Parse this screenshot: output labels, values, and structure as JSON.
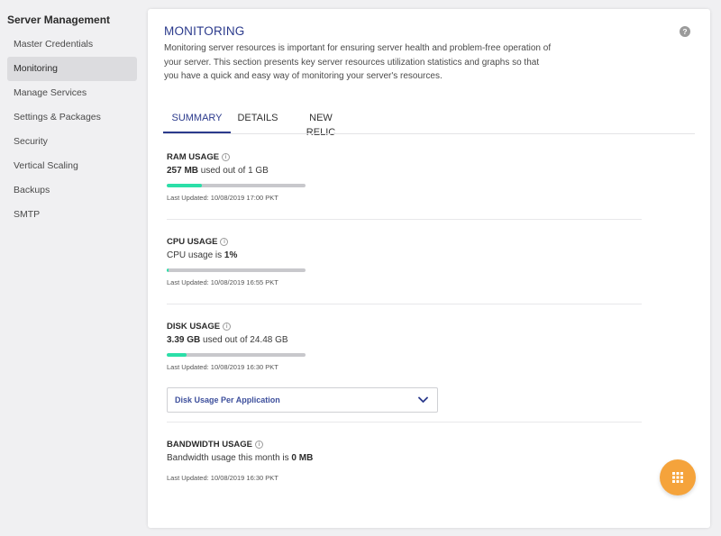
{
  "sidebar": {
    "title": "Server Management",
    "items": [
      {
        "label": "Master Credentials"
      },
      {
        "label": "Monitoring"
      },
      {
        "label": "Manage Services"
      },
      {
        "label": "Settings & Packages"
      },
      {
        "label": "Security"
      },
      {
        "label": "Vertical Scaling"
      },
      {
        "label": "Backups"
      },
      {
        "label": "SMTP"
      }
    ],
    "active_item": "Monitoring"
  },
  "main": {
    "title": "MONITORING",
    "intro": "Monitoring server resources is important for ensuring server health and problem-free operation of your server. This section presents key server resources utilization statistics and graphs so that you have a quick and easy way of monitoring your server's resources.",
    "tabs": [
      {
        "label": "SUMMARY"
      },
      {
        "label": "DETAILS"
      },
      {
        "label": "NEW RELIC"
      }
    ],
    "active_tab": "SUMMARY",
    "ram": {
      "title": "RAM USAGE",
      "used": "257 MB",
      "text_mid": "used out of",
      "total": "1 GB",
      "progress_fraction": 0.25,
      "updated": "Last Updated: 10/08/2019 17:00 PKT"
    },
    "cpu": {
      "title": "CPU USAGE",
      "text_pre": "CPU usage is",
      "value": "1%",
      "progress_fraction": 0.01,
      "updated": "Last Updated: 10/08/2019 16:55 PKT"
    },
    "disk": {
      "title": "DISK USAGE",
      "used": "3.39 GB",
      "text_mid": "used out of",
      "total": "24.48 GB",
      "progress_fraction": 0.14,
      "updated": "Last Updated: 10/08/2019 16:30 PKT",
      "dropdown_label": "Disk Usage Per Application"
    },
    "bandwidth": {
      "title": "BANDWIDTH USAGE",
      "text_pre": "Bandwidth usage this month is",
      "value": "0 MB",
      "updated": "Last Updated: 10/08/2019 16:30 PKT"
    }
  },
  "colors": {
    "accent": "#2b3a8c",
    "progress": "#2bdfa8",
    "fab": "#f5a33b"
  },
  "icons": {
    "help": "question-circle-icon",
    "info": "info-circle-icon",
    "dropdown": "chevron-down-icon",
    "fab": "grid-icon"
  }
}
